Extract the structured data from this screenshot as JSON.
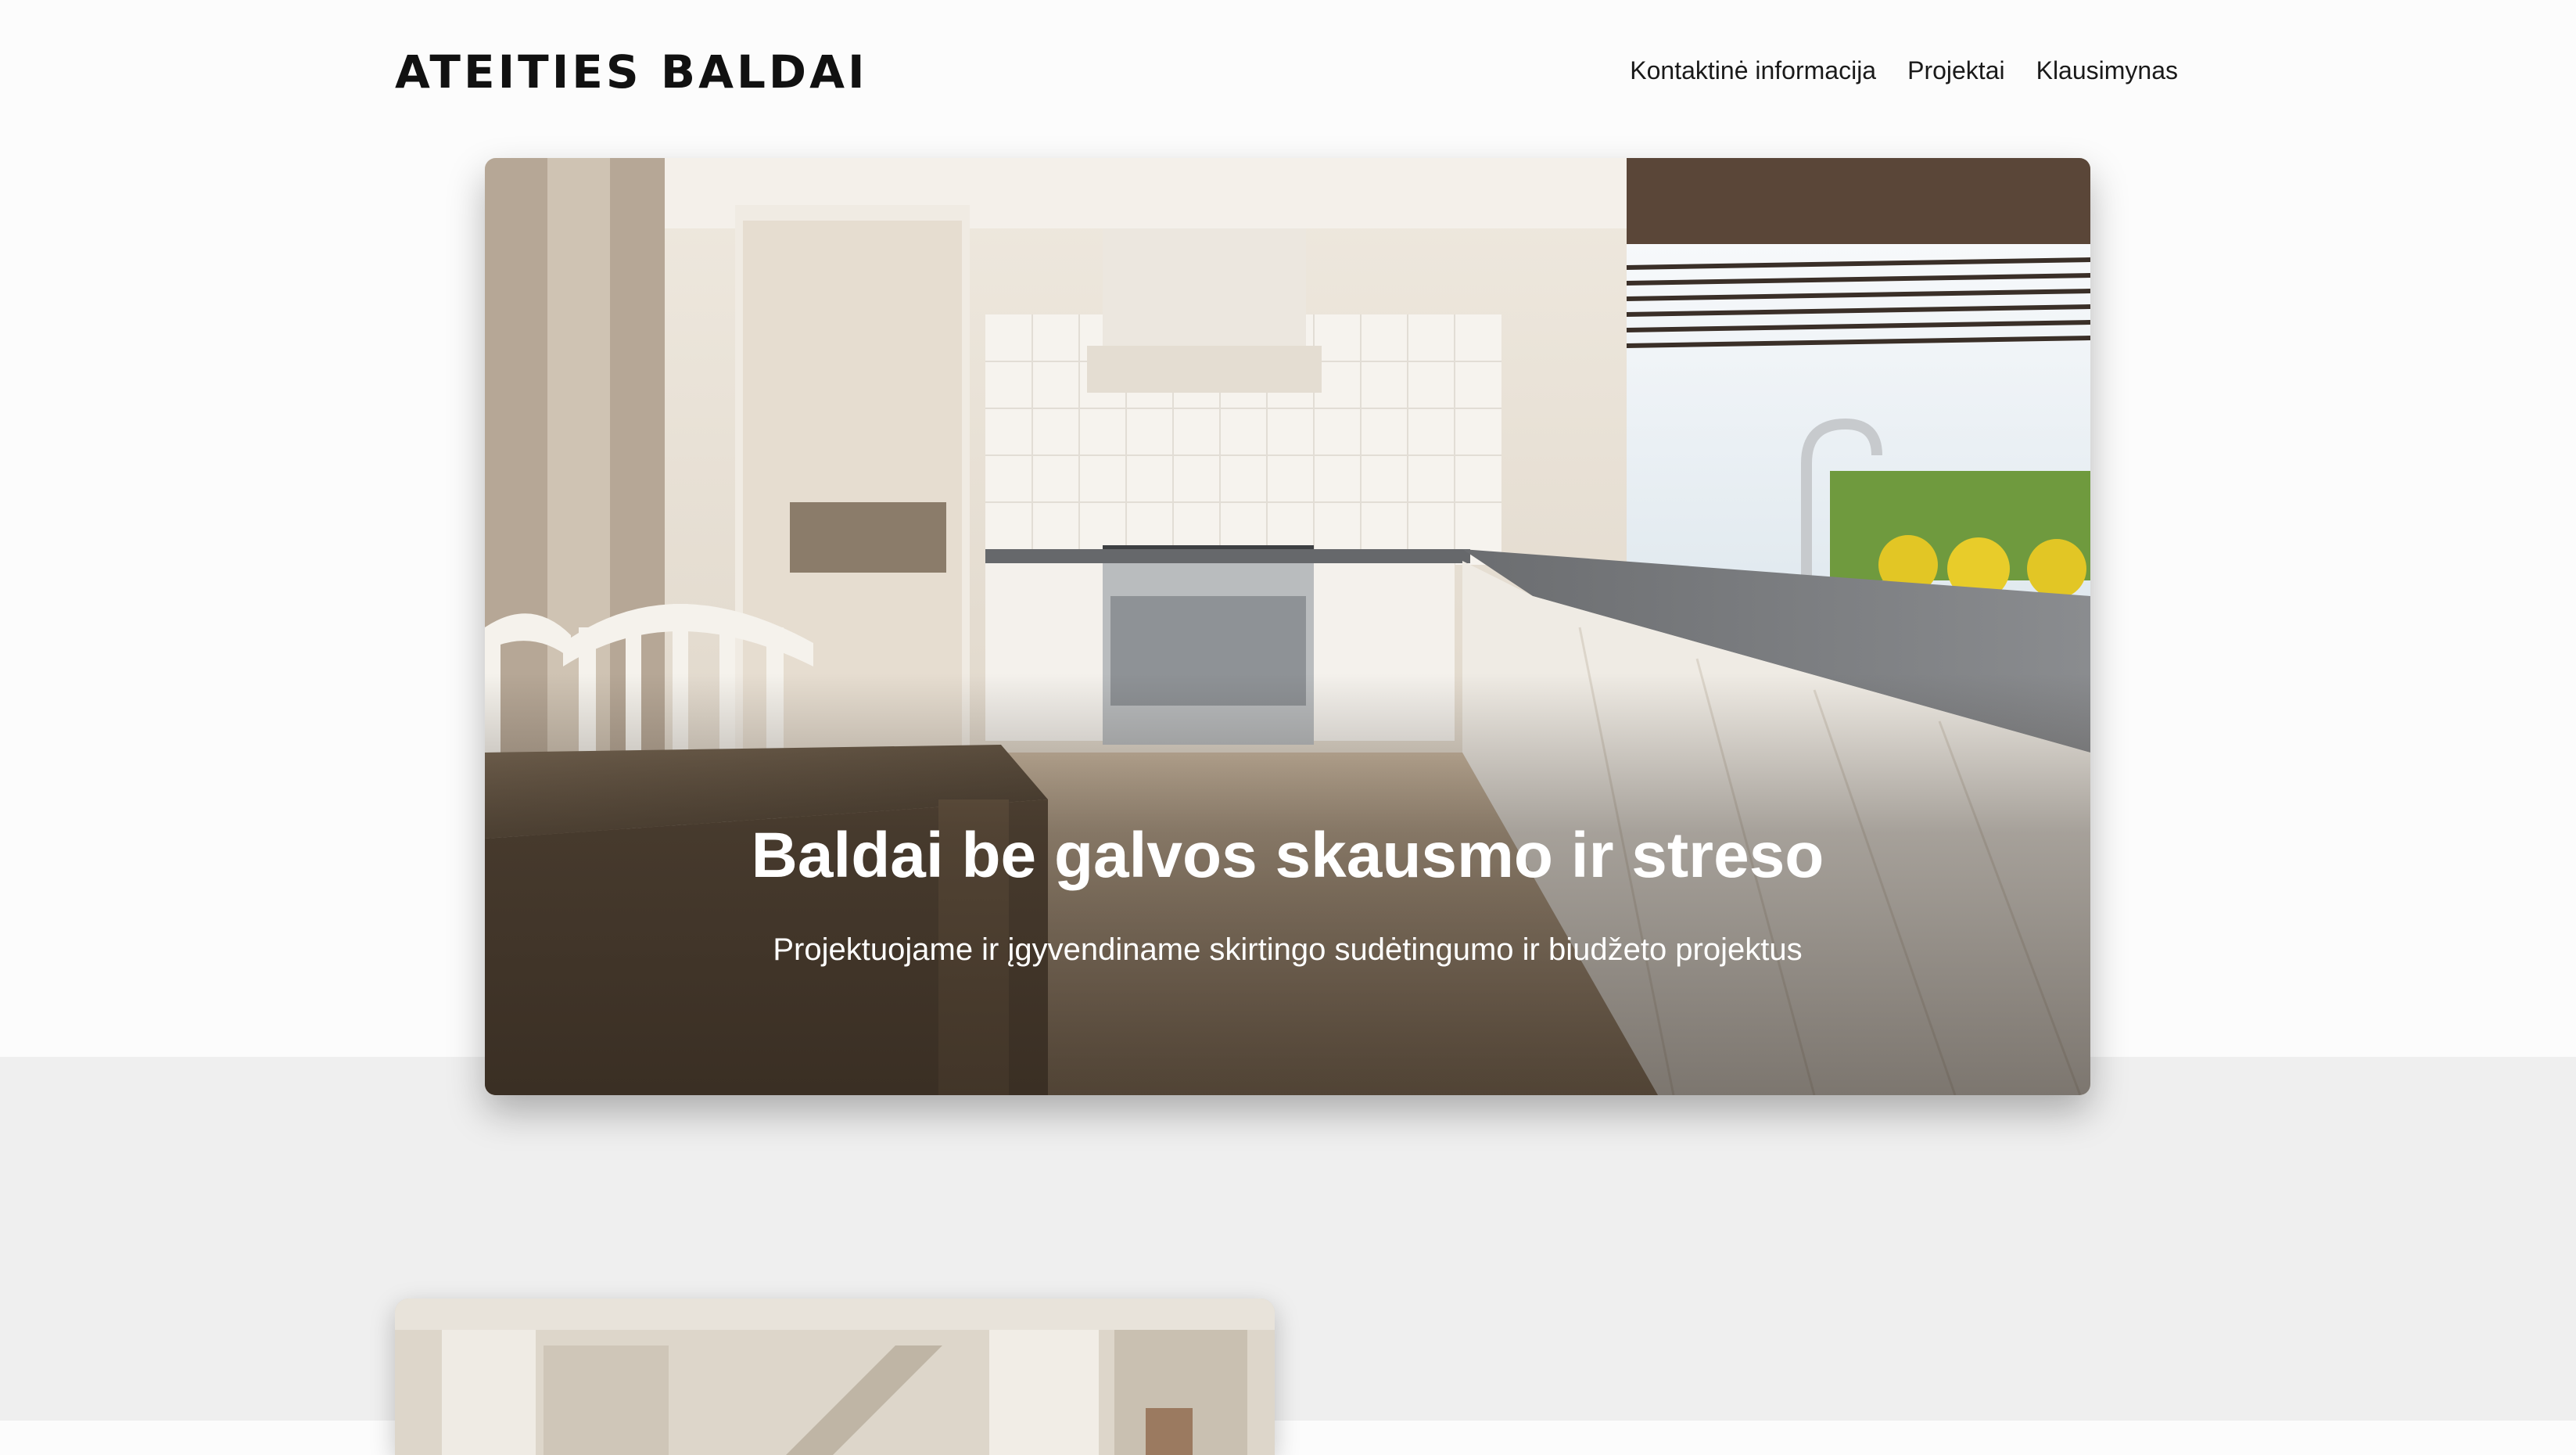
{
  "header": {
    "logo_text": "ATEITIES BALDAI",
    "nav": [
      {
        "label": "Kontaktinė informacija"
      },
      {
        "label": "Projektai"
      },
      {
        "label": "Klausimynas"
      }
    ]
  },
  "hero": {
    "title": "Baldai be galvos skausmo ir streso",
    "subtitle": "Projektuojame ir įgyvendiname skirtingo sudėtingumo ir biudžeto projektus",
    "image": "kitchen-interior-photo"
  },
  "section2": {
    "image": "interior-photo",
    "teaser_heading": ""
  },
  "colors": {
    "page_background": "#fcfcfc",
    "band_background": "#efefef",
    "teaser_accent": "#4fc3d4"
  }
}
